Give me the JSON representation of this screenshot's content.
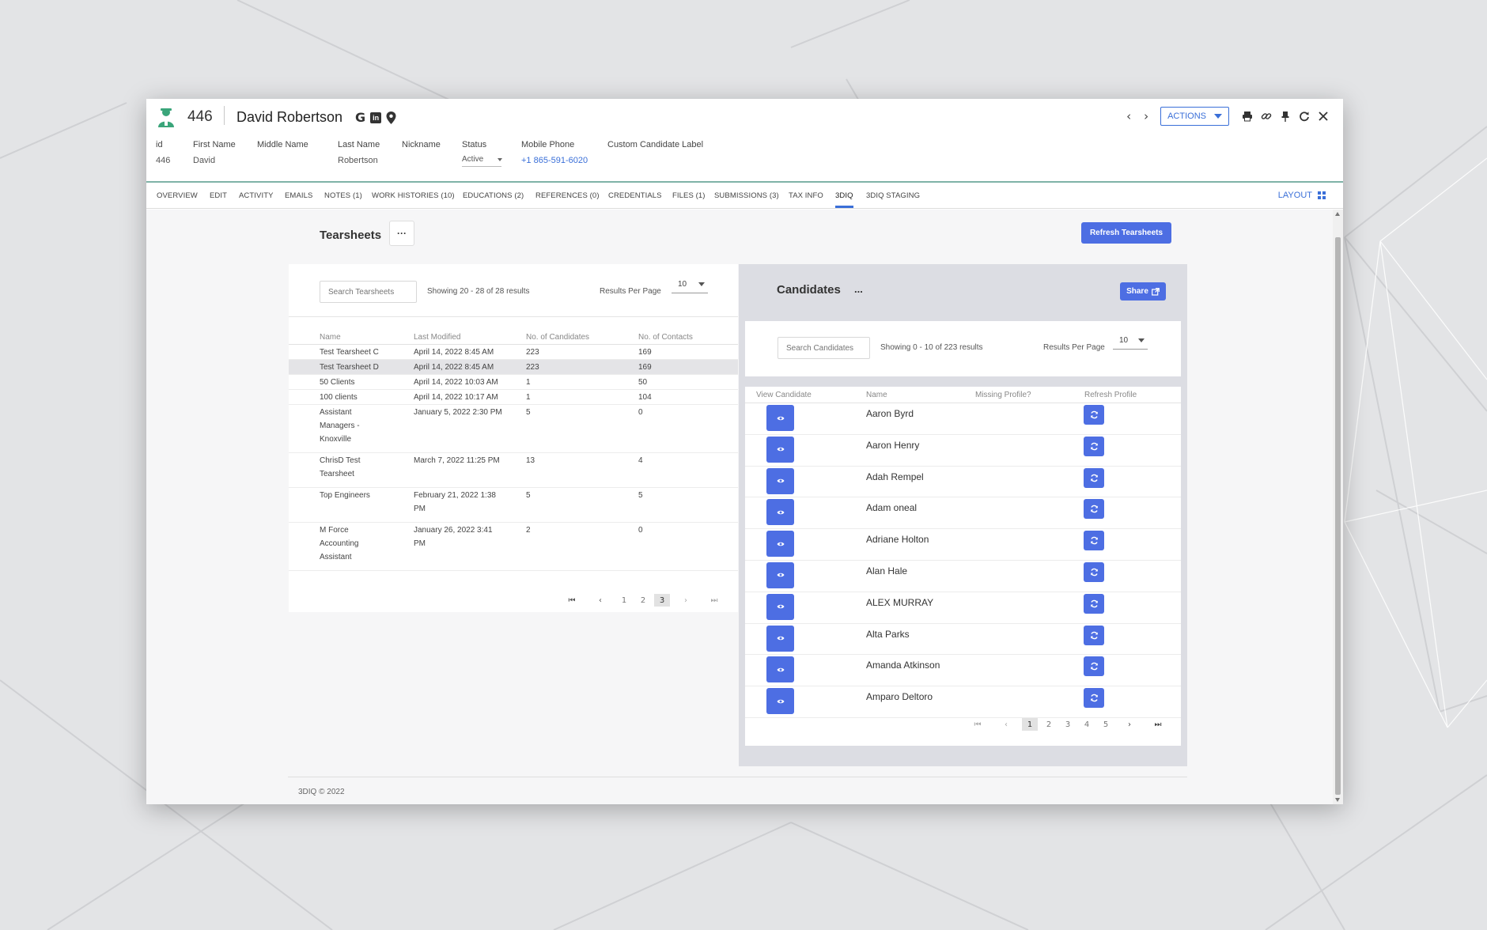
{
  "record": {
    "id": "446",
    "name": "David Robertson",
    "social_icons": [
      "google-icon",
      "linkedin-icon",
      "location-pin-icon"
    ],
    "google_glyph": "G",
    "linkedin_glyph": "in"
  },
  "fields": [
    {
      "label": "id",
      "value": "446"
    },
    {
      "label": "First Name",
      "value": "David"
    },
    {
      "label": "Middle Name",
      "value": ""
    },
    {
      "label": "Last Name",
      "value": "Robertson"
    },
    {
      "label": "Nickname",
      "value": ""
    },
    {
      "label": "Status",
      "value": "Active"
    },
    {
      "label": "Mobile Phone",
      "value": "+1 865-591-6020"
    },
    {
      "label": "Custom Candidate Label",
      "value": ""
    }
  ],
  "header_actions": {
    "actions_label": "ACTIONS",
    "icons": [
      "chevron-left-icon",
      "chevron-right-icon",
      "printer-icon",
      "link-icon",
      "pin-icon",
      "refresh-icon",
      "close-icon"
    ]
  },
  "tabs": [
    {
      "label": "OVERVIEW"
    },
    {
      "label": "EDIT"
    },
    {
      "label": "ACTIVITY"
    },
    {
      "label": "EMAILS"
    },
    {
      "label": "NOTES (1)"
    },
    {
      "label": "WORK HISTORIES (10)"
    },
    {
      "label": "EDUCATIONS (2)"
    },
    {
      "label": "REFERENCES (0)"
    },
    {
      "label": "CREDENTIALS"
    },
    {
      "label": "FILES (1)"
    },
    {
      "label": "SUBMISSIONS (3)"
    },
    {
      "label": "TAX INFO"
    },
    {
      "label": "3DIQ"
    },
    {
      "label": "3DIQ STAGING"
    }
  ],
  "active_tab": "3DIQ",
  "layout_label": "LAYOUT",
  "tearsheets": {
    "title": "Tearsheets",
    "more_label": "···",
    "refresh_label": "Refresh Tearsheets",
    "search_placeholder": "Search Tearsheets",
    "showing": "Showing 20 - 28 of 28 results",
    "rpp_label": "Results Per Page",
    "rpp_value": "10",
    "columns": [
      "Name",
      "Last Modified",
      "No. of Candidates",
      "No. of Contacts"
    ],
    "rows": [
      {
        "name": [
          "Test Tearsheet C"
        ],
        "modified": [
          "April 14, 2022 8:45 AM"
        ],
        "candidates": "223",
        "contacts": "169"
      },
      {
        "name": [
          "Test Tearsheet D"
        ],
        "modified": [
          "April 14, 2022 8:45 AM"
        ],
        "candidates": "223",
        "contacts": "169",
        "selected": true
      },
      {
        "name": [
          "50 Clients"
        ],
        "modified": [
          "April 14, 2022 10:03 AM"
        ],
        "candidates": "1",
        "contacts": "50"
      },
      {
        "name": [
          "100 clients"
        ],
        "modified": [
          "April 14, 2022 10:17 AM"
        ],
        "candidates": "1",
        "contacts": "104"
      },
      {
        "name": [
          "Assistant",
          "Managers -",
          "Knoxville"
        ],
        "modified": [
          "January 5, 2022 2:30 PM"
        ],
        "candidates": "5",
        "contacts": "0"
      },
      {
        "name": [
          "ChrisD Test",
          "Tearsheet"
        ],
        "modified": [
          "March 7, 2022 11:25 PM"
        ],
        "candidates": "13",
        "contacts": "4"
      },
      {
        "name": [
          "Top Engineers"
        ],
        "modified": [
          "February 21, 2022 1:38",
          "PM"
        ],
        "candidates": "5",
        "contacts": "5"
      },
      {
        "name": [
          "M Force",
          "Accounting",
          "Assistant"
        ],
        "modified": [
          "January 26, 2022 3:41",
          "PM"
        ],
        "candidates": "2",
        "contacts": "0"
      }
    ],
    "pager": {
      "first": "⏮",
      "prev": "‹",
      "pages": [
        "1",
        "2",
        "3"
      ],
      "active": "3",
      "next": "›",
      "last": "⏭"
    }
  },
  "candidates": {
    "title": "Candidates",
    "more_label": "...",
    "share_label": "Share",
    "search_placeholder": "Search Candidates",
    "showing": "Showing 0 - 10 of 223 results",
    "rpp_label": "Results Per Page",
    "rpp_value": "10",
    "columns": [
      "View Candidate",
      "Name",
      "Missing Profile?",
      "Refresh Profile"
    ],
    "rows": [
      {
        "name": "Aaron Byrd"
      },
      {
        "name": "Aaron Henry"
      },
      {
        "name": "Adah Rempel"
      },
      {
        "name": "Adam oneal"
      },
      {
        "name": "Adriane Holton"
      },
      {
        "name": "Alan Hale"
      },
      {
        "name": "ALEX MURRAY"
      },
      {
        "name": "Alta Parks"
      },
      {
        "name": "Amanda Atkinson"
      },
      {
        "name": "Amparo Deltoro"
      }
    ],
    "pager": {
      "first": "⏮",
      "prev": "‹",
      "pages": [
        "1",
        "2",
        "3",
        "4",
        "5"
      ],
      "active": "1",
      "next": "›",
      "last": "⏭"
    }
  },
  "footer": {
    "copyright": "3DIQ © 2022"
  },
  "colors": {
    "accent": "#3a6fd8",
    "button": "#4d6ee3",
    "avatar": "#3aa57a",
    "divider": "#7fb3a7"
  }
}
